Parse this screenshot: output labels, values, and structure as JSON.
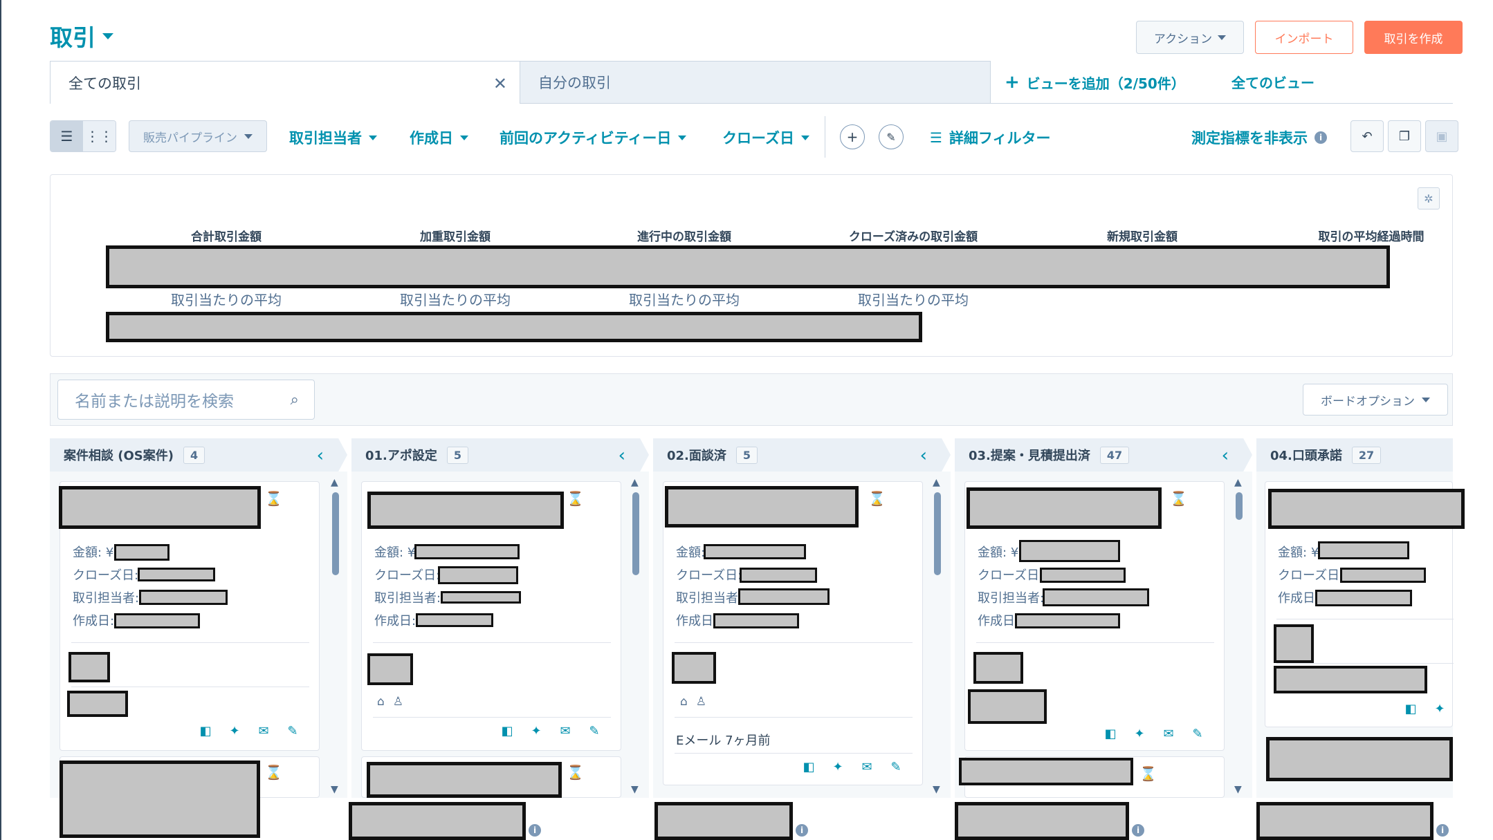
{
  "header": {
    "title": "取引",
    "actions_label": "アクション",
    "import_label": "インポート",
    "create_label": "取引を作成"
  },
  "tabs": {
    "all_deals": "全ての取引",
    "my_deals": "自分の取引",
    "add_view": "ビューを追加（2/50件）",
    "all_views": "全てのビュー"
  },
  "filters": {
    "pipeline": "販売パイプライン",
    "owner": "取引担当者",
    "created": "作成日",
    "last_activity": "前回のアクティビティー日",
    "close_date": "クローズ日",
    "advanced": "詳細フィルター",
    "hide_metrics": "測定指標を非表示"
  },
  "metrics": {
    "labels": [
      "合計取引金額",
      "加重取引金額",
      "進行中の取引金額",
      "クローズ済みの取引金額",
      "新規取引金額",
      "取引の平均経過時間"
    ],
    "sub": "取引当たりの平均"
  },
  "board": {
    "search_placeholder": "名前または説明を検索",
    "options_label": "ボードオプション"
  },
  "columns": [
    {
      "name": "案件相談 (OS案件)",
      "count": "4"
    },
    {
      "name": "01.アポ設定",
      "count": "5"
    },
    {
      "name": "02.面談済",
      "count": "5"
    },
    {
      "name": "03.提案・見積提出済",
      "count": "47"
    },
    {
      "name": "04.口頭承諾",
      "count": "27"
    }
  ],
  "card_fields": {
    "amount": "金額:",
    "yen": "¥",
    "close_date": "クローズ日:",
    "owner": "取引担当者:",
    "created": "作成日:"
  },
  "activity": {
    "email": "Eメール 7ヶ月前"
  },
  "icons": {
    "caret": "caret-down-icon",
    "plus": "plus-icon",
    "pencil": "pencil-icon",
    "filter": "filter-lines-icon",
    "info": "info-icon",
    "undo": "undo-icon",
    "copy": "copy-icon",
    "save": "save-icon",
    "gear": "gear-icon",
    "search": "search-icon",
    "hourglass": "hourglass-icon"
  },
  "colors": {
    "accent": "#0091ae",
    "primary": "#ff7a59",
    "text": "#33475b"
  }
}
